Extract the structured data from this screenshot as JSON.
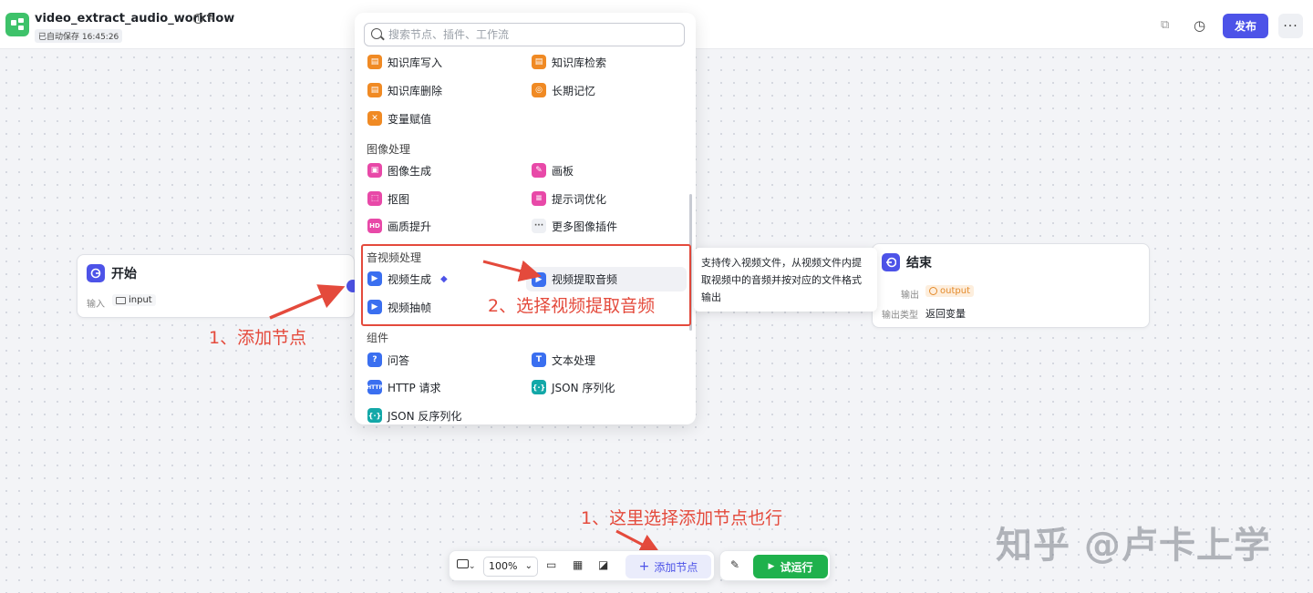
{
  "header": {
    "workflow_title": "video_extract_audio_workflow",
    "info_glyph": "i",
    "edit_glyph": "✎",
    "autosave_text": "已自动保存 16:45:26",
    "copy_glyph": "⧉",
    "history_glyph": "◷",
    "publish_label": "发布",
    "more_glyph": "···"
  },
  "start_node": {
    "title": "开始",
    "input_label": "输入",
    "input_value": "input"
  },
  "end_node": {
    "title": "结束",
    "output_label": "输出",
    "output_value": "output",
    "output_type_label": "输出类型",
    "output_type_value": "返回变量"
  },
  "picker": {
    "search_placeholder": "搜索节点、插件、工作流",
    "groups": {
      "knowledge": {
        "items": [
          "知识库写入",
          "知识库检索",
          "知识库删除",
          "长期记忆",
          "变量赋值"
        ]
      },
      "image": {
        "title": "图像处理",
        "items": [
          "图像生成",
          "画板",
          "抠图",
          "提示词优化",
          "画质提升",
          "更多图像插件"
        ]
      },
      "av": {
        "title": "音视频处理",
        "items": [
          "视频生成",
          "视频提取音频",
          "视频抽帧"
        ]
      },
      "components": {
        "title": "组件",
        "items": [
          "问答",
          "文本处理",
          "HTTP 请求",
          "JSON 序列化",
          "JSON 反序列化"
        ]
      }
    }
  },
  "tooltip": {
    "text": "支持传入视频文件，从视频文件内提取视频中的音频并按对应的文件格式输出"
  },
  "annotations": {
    "step1": "1、添加节点",
    "step2": "2、选择视频提取音频",
    "step1_alt": "1、这里选择添加节点也行"
  },
  "toolbar": {
    "zoom_value": "100%",
    "add_node_label": "添加节点",
    "run_label": "试运行"
  },
  "watermark": "知乎 @卢卡上学",
  "colors": {
    "brand": "#4d53e8",
    "run": "#1fb14c",
    "annotation": "#e44a3c",
    "app_logo": "#3ec26a"
  },
  "icons": {
    "search": "search-icon",
    "start": "start-icon",
    "end": "end-icon",
    "diamond": "diamond-icon"
  }
}
